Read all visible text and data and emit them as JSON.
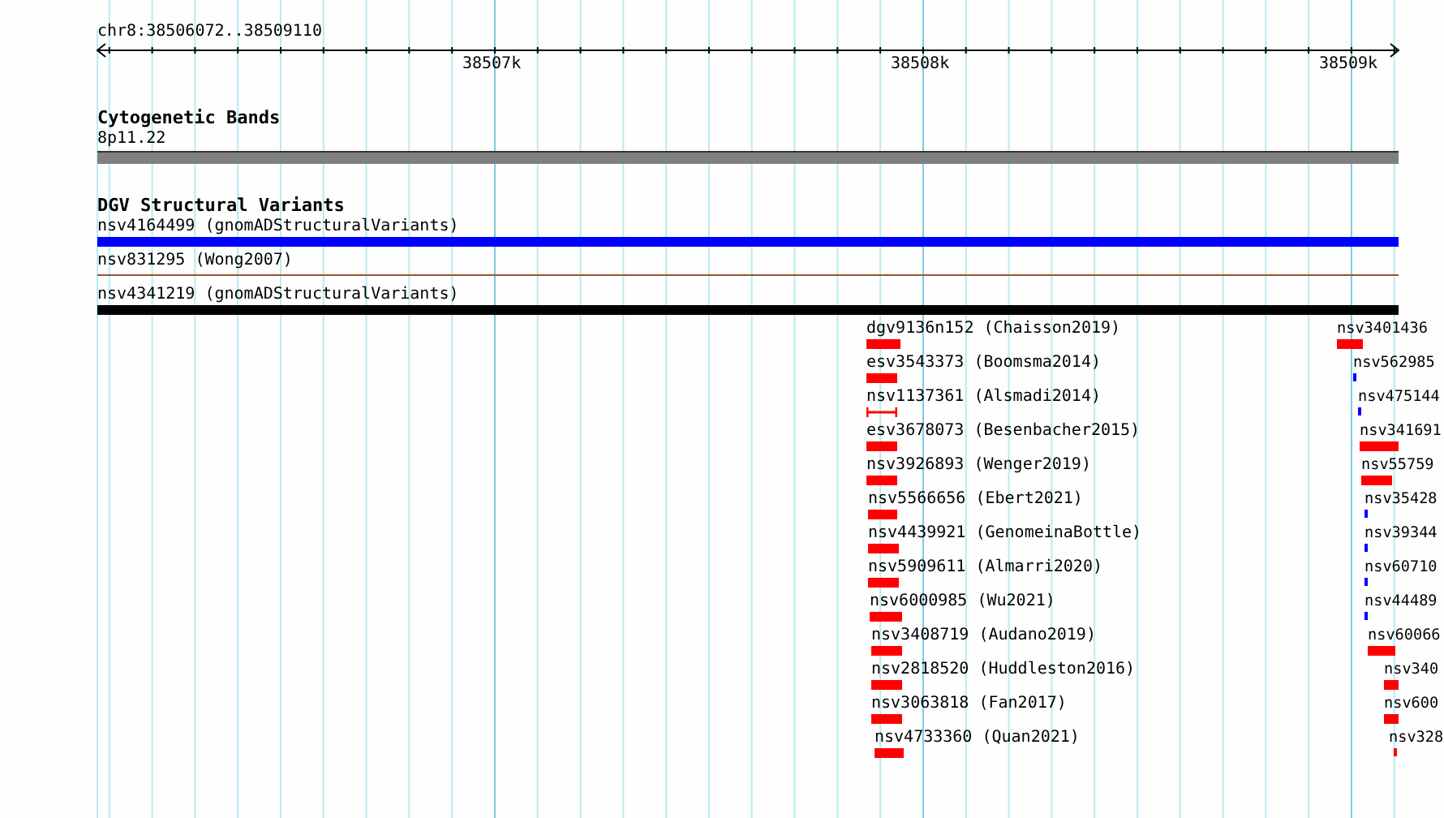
{
  "ruler": {
    "location": "chr8:38506072..38509110",
    "ticks": [
      "38507k",
      "38508k",
      "38509k"
    ]
  },
  "tracks": [
    {
      "title": "Cytogenetic Bands",
      "features": [
        {
          "label": "8p11.22",
          "kind": "band",
          "color": "#808080"
        }
      ]
    },
    {
      "title": "DGV Structural Variants",
      "features": [
        {
          "label": "nsv4164499 (gnomADStructuralVariants)",
          "kind": "bar",
          "color": "#0000ff"
        },
        {
          "label": "nsv831295 (Wong2007)",
          "kind": "line",
          "color": "#a0522d"
        },
        {
          "label": "nsv4341219 (gnomADStructuralVariants)",
          "kind": "bar",
          "color": "#000000"
        }
      ],
      "stacks": [
        [
          {
            "label": "dgv9136n152 (Chaisson2019)",
            "kind": "bar",
            "color": "#ff0000"
          },
          {
            "label": "esv3543373 (Boomsma2014)",
            "kind": "bar",
            "color": "#ff0000"
          },
          {
            "label": "nsv1137361 (Alsmadi2014)",
            "kind": "span",
            "color": "#ff0000"
          },
          {
            "label": "esv3678073 (Besenbacher2015)",
            "kind": "bar",
            "color": "#ff0000"
          },
          {
            "label": "nsv3926893 (Wenger2019)",
            "kind": "bar",
            "color": "#ff0000"
          },
          {
            "label": "nsv5566656 (Ebert2021)",
            "kind": "bar",
            "color": "#ff0000"
          },
          {
            "label": "nsv4439921 (GenomeinaBottle)",
            "kind": "bar",
            "color": "#ff0000"
          },
          {
            "label": "nsv5909611 (Almarri2020)",
            "kind": "bar",
            "color": "#ff0000"
          },
          {
            "label": "nsv6000985 (Wu2021)",
            "kind": "bar",
            "color": "#ff0000"
          },
          {
            "label": "nsv3408719 (Audano2019)",
            "kind": "bar",
            "color": "#ff0000"
          },
          {
            "label": "nsv2818520 (Huddleston2016)",
            "kind": "bar",
            "color": "#ff0000"
          },
          {
            "label": "nsv3063818 (Fan2017)",
            "kind": "bar",
            "color": "#ff0000"
          },
          {
            "label": "nsv4733360 (Quan2021)",
            "kind": "bar",
            "color": "#ff0000"
          }
        ],
        [
          {
            "label": "nsv3401436",
            "kind": "bar",
            "color": "#ff0000"
          },
          {
            "label": "nsv562985",
            "kind": "bar",
            "color": "#0000ff"
          },
          {
            "label": "nsv475144",
            "kind": "bar",
            "color": "#0000ff"
          },
          {
            "label": "nsv341691",
            "kind": "bar",
            "color": "#ff0000"
          },
          {
            "label": "nsv55759",
            "kind": "bar",
            "color": "#ff0000"
          },
          {
            "label": "nsv35428",
            "kind": "bar",
            "color": "#0000ff"
          },
          {
            "label": "nsv39344",
            "kind": "bar",
            "color": "#0000ff"
          },
          {
            "label": "nsv60710",
            "kind": "bar",
            "color": "#0000ff"
          },
          {
            "label": "nsv44489",
            "kind": "bar",
            "color": "#0000ff"
          },
          {
            "label": "nsv60066",
            "kind": "bar",
            "color": "#ff0000"
          },
          {
            "label": "nsv340",
            "kind": "bar",
            "color": "#ff0000"
          },
          {
            "label": "nsv600",
            "kind": "bar",
            "color": "#ff0000"
          },
          {
            "label": "nsv328",
            "kind": "bar",
            "color": "#ff0000"
          }
        ]
      ]
    }
  ]
}
